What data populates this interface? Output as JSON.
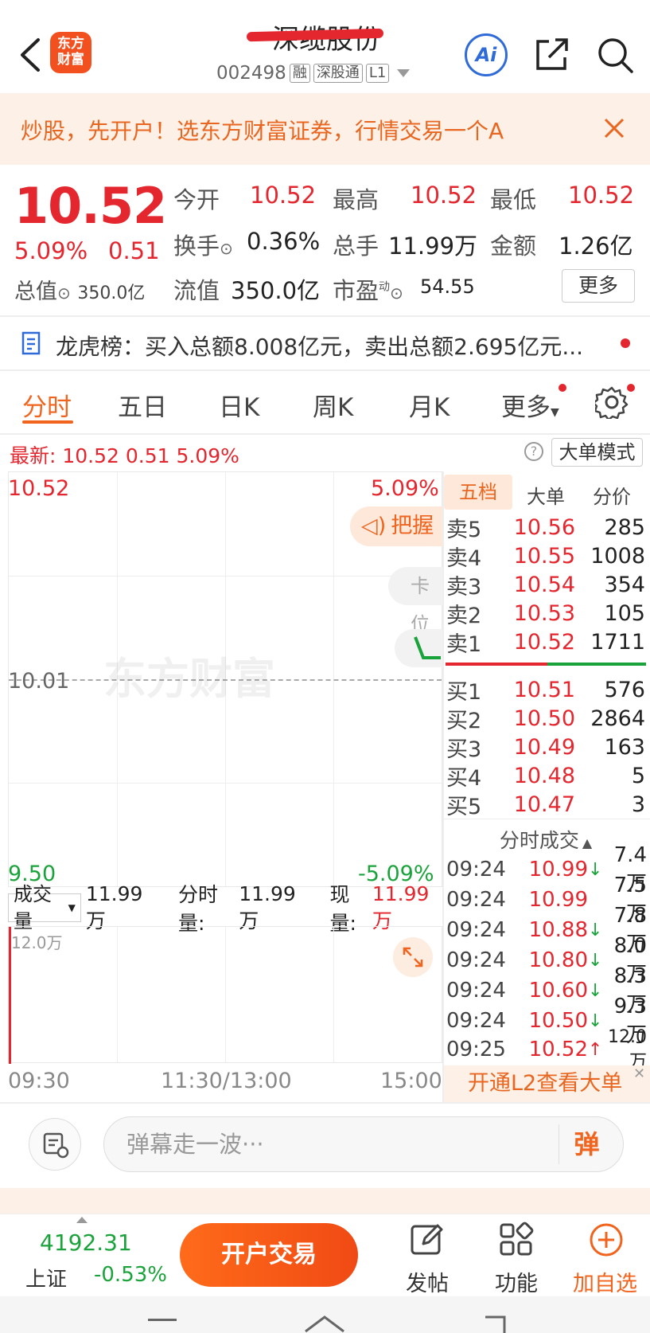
{
  "header": {
    "logo_line1": "东方",
    "logo_line2": "财富",
    "stock_name": "深缆股份",
    "stock_code": "002498",
    "tags": [
      "融",
      "深股通",
      "L1"
    ],
    "ai_label": "Ai"
  },
  "banner": {
    "text": "炒股，先开户！选东方财富证券，行情交易一个A"
  },
  "quote": {
    "price": "10.52",
    "change_pct": "5.09%",
    "change_val": "0.51",
    "market_value_label": "总值",
    "market_value": "350.0亿",
    "open_label": "今开",
    "open": "10.52",
    "high_label": "最高",
    "high": "10.52",
    "low_label": "最低",
    "low": "10.52",
    "turnover_label": "换手",
    "turnover": "0.36%",
    "volume_label": "总手",
    "volume": "11.99万",
    "amount_label": "金额",
    "amount": "1.26亿",
    "float_label": "流值",
    "float_value": "350.0亿",
    "pe_label": "市盈",
    "pe_sup": "动",
    "pe": "54.55",
    "more": "更多"
  },
  "dragon_tiger": {
    "text": "龙虎榜：买入总额8.008亿元，卖出总额2.695亿元..."
  },
  "tabs": [
    "分时",
    "五日",
    "日K",
    "周K",
    "月K",
    "更多"
  ],
  "latest_bar": {
    "text": "最新: 10.52  0.51  5.09%",
    "help": "?",
    "big_mode": "大单模式"
  },
  "chart": {
    "top_price": "10.52",
    "top_pct": "5.09%",
    "mid_price": "10.01",
    "bottom_price": "9.50",
    "bottom_pct": "-5.09%",
    "watermark": "东方财富",
    "grasp_label": "把握",
    "kawei_label": "卡位",
    "time_start": "09:30",
    "time_mid": "11:30/13:00",
    "time_end": "15:00"
  },
  "volume_bar": {
    "selector": "成交量",
    "total": "11.99万",
    "minute_label": "分时量:",
    "minute_val": "11.99万",
    "current_label": "现量:",
    "current_val": "11.99万",
    "axis_max": "12.0万"
  },
  "order_book": {
    "tabs": [
      "五档",
      "大单",
      "分价"
    ],
    "asks": [
      {
        "label": "卖5",
        "price": "10.56",
        "qty": "285"
      },
      {
        "label": "卖4",
        "price": "10.55",
        "qty": "1008"
      },
      {
        "label": "卖3",
        "price": "10.54",
        "qty": "354"
      },
      {
        "label": "卖2",
        "price": "10.53",
        "qty": "105"
      },
      {
        "label": "卖1",
        "price": "10.52",
        "qty": "1711"
      }
    ],
    "bids": [
      {
        "label": "买1",
        "price": "10.51",
        "qty": "576"
      },
      {
        "label": "买2",
        "price": "10.50",
        "qty": "2864"
      },
      {
        "label": "买3",
        "price": "10.49",
        "qty": "163"
      },
      {
        "label": "买4",
        "price": "10.48",
        "qty": "5"
      },
      {
        "label": "买5",
        "price": "10.47",
        "qty": "3"
      }
    ]
  },
  "ticks": {
    "title": "分时成交",
    "rows": [
      {
        "time": "09:24",
        "price": "10.99",
        "dir": "↓",
        "vol": "7.4万"
      },
      {
        "time": "09:24",
        "price": "10.99",
        "dir": "",
        "vol": "7.5万"
      },
      {
        "time": "09:24",
        "price": "10.88",
        "dir": "↓",
        "vol": "7.8万"
      },
      {
        "time": "09:24",
        "price": "10.80",
        "dir": "↓",
        "vol": "8.0万"
      },
      {
        "time": "09:24",
        "price": "10.60",
        "dir": "↓",
        "vol": "8.3万"
      },
      {
        "time": "09:24",
        "price": "10.50",
        "dir": "↓",
        "vol": "9.3万"
      },
      {
        "time": "09:25",
        "price": "10.52",
        "dir": "↑",
        "vol": "12.0万"
      }
    ],
    "l2_promo": "开通L2查看大单"
  },
  "danmu": {
    "placeholder": "弹幕走一波···",
    "send": "弹"
  },
  "bottom": {
    "index_value": "4192.31",
    "index_name": "上证",
    "index_change": "-0.53%",
    "trade_btn": "开户交易",
    "post": "发帖",
    "func": "功能",
    "add": "加自选"
  },
  "colors": {
    "up": "#e4262e",
    "down": "#1aa33a",
    "accent": "#f0641e"
  }
}
